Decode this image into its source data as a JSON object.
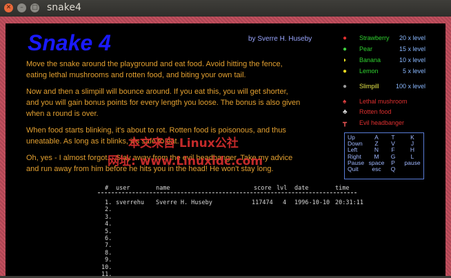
{
  "window": {
    "title": "snake4"
  },
  "header": {
    "title": "Snake 4",
    "byline": "by Sverre H. Huseby"
  },
  "description": [
    "Move the snake around the playground and eat food. Avoid hitting the fence, eating lethal mushrooms and rotten food, and biting your own tail.",
    "Now and then a slimpill will bounce around. If you eat this, you will get shorter, and you will gain bonus points for every length you loose. The bonus is also given when a round is over.",
    "When food starts blinking, it's about to rot. Rotten food is poisonous, and thus uneatable. As long as it blinks, it's safe to eat.",
    "Oh, yes - I almost forgot... Stay away from the evil headbanger. Take my advice and run away from him before he hits you in the head! He won't stay long."
  ],
  "legend": [
    {
      "icon": "strawberry-icon",
      "name": "Strawberry",
      "value": "20 x level",
      "color": "#2fd12f"
    },
    {
      "icon": "pear-icon",
      "name": "Pear",
      "value": "15 x level",
      "color": "#2fd12f"
    },
    {
      "icon": "banana-icon",
      "name": "Banana",
      "value": "10 x level",
      "color": "#2fd12f"
    },
    {
      "icon": "lemon-icon",
      "name": "Lemon",
      "value": "5 x level",
      "color": "#2fd12f"
    },
    {
      "icon": "slimpill-icon",
      "name": "Slimpill",
      "value": "100 x level",
      "color": "#e8e84a"
    },
    {
      "icon": "mushroom-icon",
      "name": "Lethal mushroom",
      "value": "",
      "color": "#e03030"
    },
    {
      "icon": "rotten-food-icon",
      "name": "Rotten food",
      "value": "",
      "color": "#e03030"
    },
    {
      "icon": "headbanger-icon",
      "name": "Evil headbanger",
      "value": "",
      "color": "#e03030"
    }
  ],
  "keys": {
    "actions": [
      "Up",
      "Down",
      "Left",
      "Right",
      "Pause",
      "Quit"
    ],
    "set1": [
      "A",
      "Z",
      "N",
      "M",
      "space",
      "esc"
    ],
    "set2": [
      "T",
      "V",
      "F",
      "G",
      "P",
      "Q"
    ],
    "set3": [
      "K",
      "J",
      "H",
      "L",
      "pause",
      ""
    ]
  },
  "highscores": {
    "headers": {
      "num": "#",
      "user": "user",
      "name": "name",
      "score": "score",
      "lvl": "lvl",
      "date": "date",
      "time": "time"
    },
    "rows": [
      {
        "num": "1.",
        "user": "sverrehu",
        "name": "Sverre H. Huseby",
        "score": "117474",
        "lvl": "4",
        "date": "1996-10-10",
        "time": "20:31:11"
      },
      {
        "num": "2.",
        "user": "",
        "name": "",
        "score": "",
        "lvl": "",
        "date": "",
        "time": ""
      },
      {
        "num": "3.",
        "user": "",
        "name": "",
        "score": "",
        "lvl": "",
        "date": "",
        "time": ""
      },
      {
        "num": "4.",
        "user": "",
        "name": "",
        "score": "",
        "lvl": "",
        "date": "",
        "time": ""
      },
      {
        "num": "5.",
        "user": "",
        "name": "",
        "score": "",
        "lvl": "",
        "date": "",
        "time": ""
      },
      {
        "num": "6.",
        "user": "",
        "name": "",
        "score": "",
        "lvl": "",
        "date": "",
        "time": ""
      },
      {
        "num": "7.",
        "user": "",
        "name": "",
        "score": "",
        "lvl": "",
        "date": "",
        "time": ""
      },
      {
        "num": "8.",
        "user": "",
        "name": "",
        "score": "",
        "lvl": "",
        "date": "",
        "time": ""
      },
      {
        "num": "9.",
        "user": "",
        "name": "",
        "score": "",
        "lvl": "",
        "date": "",
        "time": ""
      },
      {
        "num": "10.",
        "user": "",
        "name": "",
        "score": "",
        "lvl": "",
        "date": "",
        "time": ""
      },
      {
        "num": "11.",
        "user": "",
        "name": "",
        "score": "",
        "lvl": "",
        "date": "",
        "time": ""
      }
    ]
  },
  "watermark": {
    "line1": "本文来自 Linux公社",
    "line2": "网址: www.Linuxidc.com"
  }
}
